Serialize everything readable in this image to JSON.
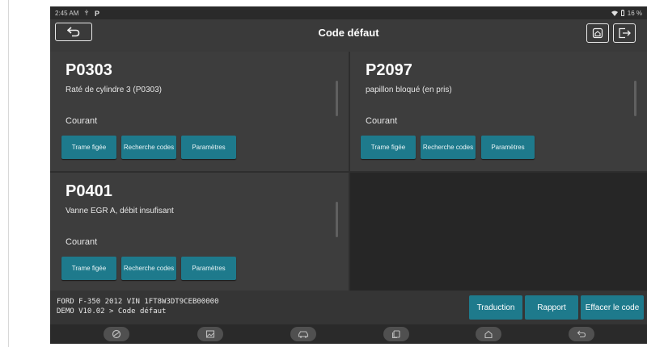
{
  "status_bar": {
    "time": "2:45 AM",
    "battery": "16 %"
  },
  "header": {
    "title": "Code défaut"
  },
  "dtc_panels": [
    {
      "code": "P0303",
      "description": "Raté de cylindre 3 (P0303)",
      "status": "Courant",
      "buttons": [
        "Trame figée",
        "Recherche codes",
        "Paramètres"
      ]
    },
    {
      "code": "P2097",
      "description": "papillon bloqué (en pris)",
      "status": "Courant",
      "buttons": [
        "Trame figée",
        "Recherche codes",
        "Paramètres"
      ]
    },
    {
      "code": "P0401",
      "description": "Vanne EGR A, débit insufisant",
      "status": "Courant",
      "buttons": [
        "Trame figée",
        "Recherche codes",
        "Paramètres"
      ]
    }
  ],
  "vehicle": {
    "line1": "FORD  F-350  2012  VIN  1FT8W3DT9CEB00000",
    "line2": "DEMO V10.02 > Code défaut"
  },
  "footer_buttons": {
    "translate": "Traduction",
    "report": "Rapport",
    "clear": "Effacer le code"
  },
  "nav_icons": [
    "diagnose-icon",
    "image-icon",
    "car-icon",
    "recent-apps-icon",
    "home-icon",
    "back-icon"
  ],
  "colors": {
    "accent": "#1e7a8c",
    "panel": "#3d3d3d",
    "background": "#2e2e2e"
  }
}
